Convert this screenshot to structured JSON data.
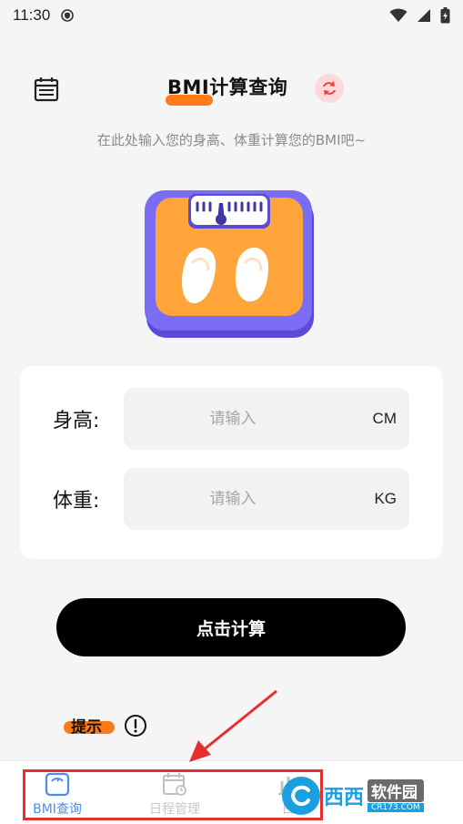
{
  "status_bar": {
    "time": "11:30"
  },
  "header": {
    "title": "BMI计算查询"
  },
  "subtitle": "在此处输入您的身高、体重计算您的BMI吧~",
  "form": {
    "height": {
      "label": "身高:",
      "placeholder": "请输入",
      "unit": "CM"
    },
    "weight": {
      "label": "体重:",
      "placeholder": "请输入",
      "unit": "KG"
    }
  },
  "calculate_button": "点击计算",
  "tip": {
    "label": "提示"
  },
  "tabbar": {
    "tabs": [
      {
        "label": "BMI查询",
        "icon": "scale-icon",
        "active": true
      },
      {
        "label": "日程管理",
        "icon": "calendar-clock-icon",
        "active": false
      },
      {
        "label": "白",
        "icon": "chart-icon",
        "active": false
      }
    ]
  },
  "watermark": {
    "brand": "西西",
    "name": "软件园",
    "url": "CR173.COM"
  },
  "colors": {
    "accent_orange": "#ff7a18",
    "active_tab": "#4a8cff",
    "button_black": "#000000",
    "scale_body": "#ffa53a",
    "scale_frame": "#7b6cf6",
    "annotation_red": "#e53030"
  }
}
